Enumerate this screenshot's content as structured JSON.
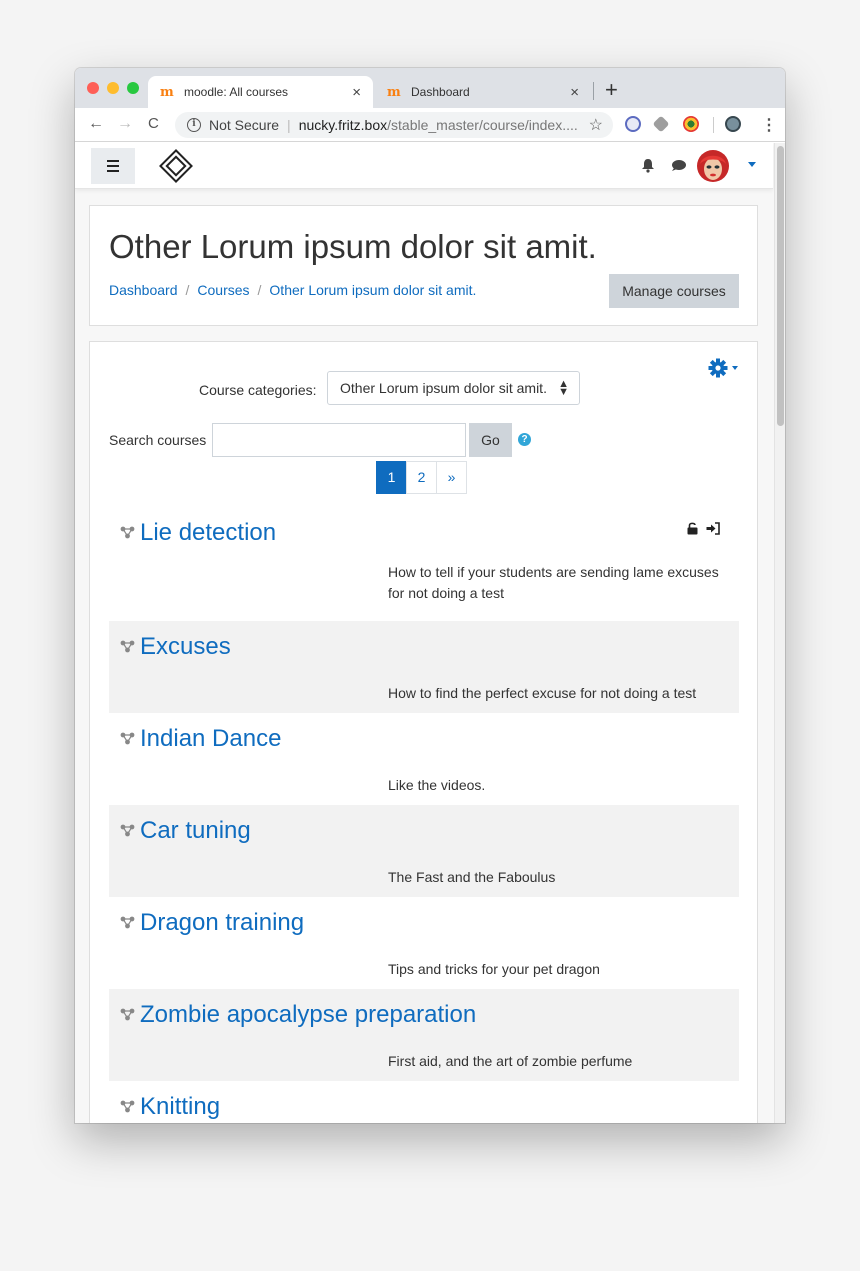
{
  "browser": {
    "tabs": [
      {
        "title": "moodle: All courses",
        "close": "×",
        "logo": "m"
      },
      {
        "title": "Dashboard",
        "close": "×",
        "logo": "m"
      }
    ],
    "new_tab": "+",
    "back": "←",
    "forward": "→",
    "reload": "C",
    "security_icon": "i",
    "security_text": "Not Secure",
    "separator": "|",
    "url_host": "nucky.fritz.box",
    "url_path": "/stable_master/course/index....",
    "bookmark_star": "☆",
    "menu": "⋮"
  },
  "page": {
    "title": "Other Lorum ipsum dolor sit amit.",
    "breadcrumb": [
      "Dashboard",
      "Courses",
      "Other Lorum ipsum dolor sit amit."
    ],
    "breadcrumb_divider": "/",
    "manage_button": "Manage courses"
  },
  "filters": {
    "category_label": "Course categories:",
    "category_value": "Other Lorum ipsum dolor sit amit.",
    "select_arrows": "▲\n▼",
    "search_label": "Search courses",
    "search_value": "",
    "go_button": "Go",
    "help": "?"
  },
  "pagination": {
    "pages": [
      "1",
      "2",
      "»"
    ],
    "current": "1"
  },
  "courses": [
    {
      "name": "Lie detection",
      "summary": "How to tell if your students are sending lame excuses for not doing a test"
    },
    {
      "name": "Excuses",
      "summary": "How to find the perfect excuse for not doing a test"
    },
    {
      "name": "Indian Dance",
      "summary": "Like the videos."
    },
    {
      "name": "Car tuning",
      "summary": "The Fast and the Faboulus"
    },
    {
      "name": "Dragon training",
      "summary": "Tips and tricks for your pet dragon"
    },
    {
      "name": "Zombie apocalypse preparation",
      "summary": "First aid, and the art of zombie perfume"
    },
    {
      "name": "Knitting",
      "summary": ""
    }
  ],
  "colors": {
    "link": "#0f6cbf",
    "shaded_row": "#f2f2f2",
    "button": "#ced4da",
    "moodle_orange": "#f98012"
  },
  "icons": [
    "hamburger-icon",
    "site-logo",
    "bell-icon",
    "chat-icon",
    "avatar",
    "gear-icon",
    "help-icon",
    "course-icon",
    "unlock-icon",
    "enrol-icon"
  ]
}
